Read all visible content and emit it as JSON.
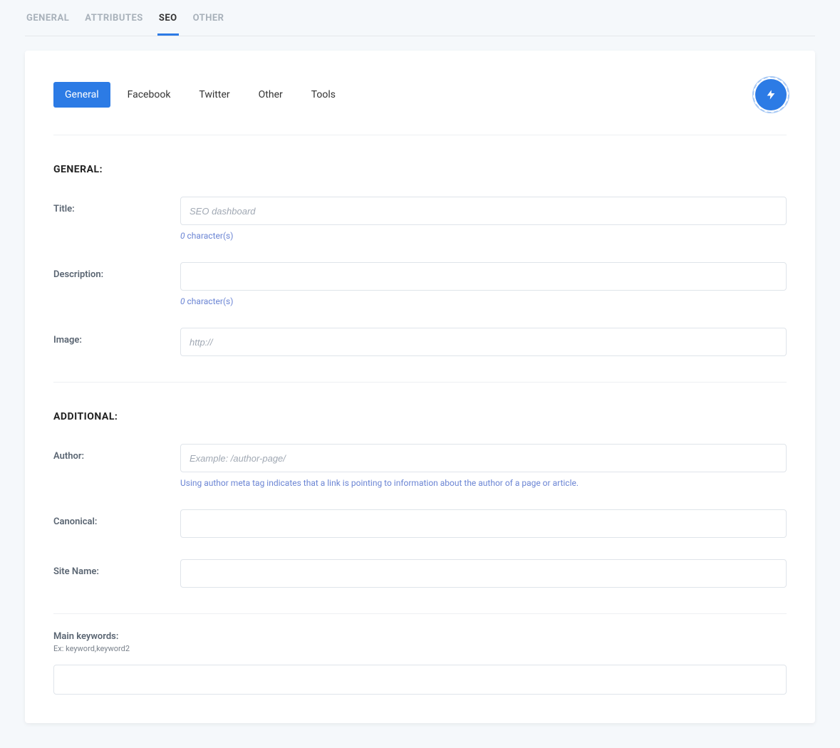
{
  "topTabs": [
    {
      "label": "GENERAL",
      "active": false
    },
    {
      "label": "ATTRIBUTES",
      "active": false
    },
    {
      "label": "SEO",
      "active": true
    },
    {
      "label": "OTHER",
      "active": false
    }
  ],
  "innerTabs": [
    {
      "label": "General",
      "active": true
    },
    {
      "label": "Facebook",
      "active": false
    },
    {
      "label": "Twitter",
      "active": false
    },
    {
      "label": "Other",
      "active": false
    },
    {
      "label": "Tools",
      "active": false
    }
  ],
  "sections": {
    "general": {
      "title": "GENERAL:",
      "fields": {
        "title": {
          "label": "Title:",
          "placeholder": "SEO dashboard",
          "value": "",
          "count": "0",
          "countSuffix": " character(s)"
        },
        "description": {
          "label": "Description:",
          "value": "",
          "count": "0",
          "countSuffix": " character(s)"
        },
        "image": {
          "label": "Image:",
          "placeholder": "http://",
          "value": ""
        }
      }
    },
    "additional": {
      "title": "ADDITIONAL:",
      "fields": {
        "author": {
          "label": "Author:",
          "placeholder": "Example: /author-page/",
          "value": "",
          "help": "Using author meta tag indicates that a link is pointing to information about the author of a page or article."
        },
        "canonical": {
          "label": "Canonical:",
          "value": ""
        },
        "siteName": {
          "label": "Site Name:",
          "value": ""
        }
      }
    },
    "keywords": {
      "label": "Main keywords:",
      "sub": "Ex: keyword,keyword2",
      "value": ""
    }
  }
}
